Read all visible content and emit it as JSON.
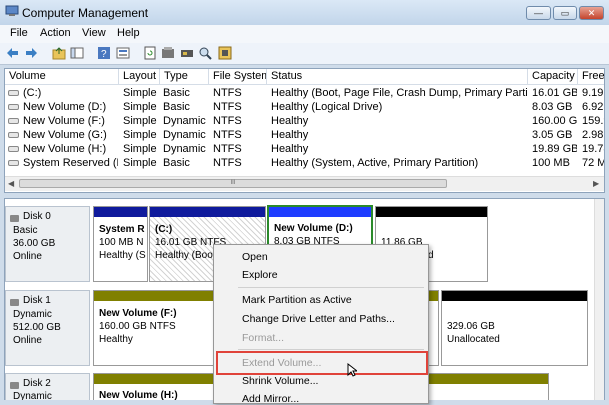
{
  "window": {
    "title": "Computer Management",
    "minimize": "—",
    "maximize": "▭",
    "close": "✕"
  },
  "menu": [
    "File",
    "Action",
    "View",
    "Help"
  ],
  "list": {
    "columns": [
      "Volume",
      "Layout",
      "Type",
      "File System",
      "Status",
      "Capacity",
      "Free"
    ],
    "rows": [
      [
        "(C:)",
        "Simple",
        "Basic",
        "NTFS",
        "Healthy (Boot, Page File, Crash Dump, Primary Partition)",
        "16.01 GB",
        "9.19"
      ],
      [
        "New Volume (D:)",
        "Simple",
        "Basic",
        "NTFS",
        "Healthy (Logical Drive)",
        "8.03 GB",
        "6.92"
      ],
      [
        "New Volume (F:)",
        "Simple",
        "Dynamic",
        "NTFS",
        "Healthy",
        "160.00 GB",
        "159.9"
      ],
      [
        "New Volume (G:)",
        "Simple",
        "Dynamic",
        "NTFS",
        "Healthy",
        "3.05 GB",
        "2.98"
      ],
      [
        "New Volume (H:)",
        "Simple",
        "Dynamic",
        "NTFS",
        "Healthy",
        "19.89 GB",
        "19.78"
      ],
      [
        "System Reserved (E:)",
        "Simple",
        "Basic",
        "NTFS",
        "Healthy (System, Active, Primary Partition)",
        "100 MB",
        "72 M"
      ]
    ],
    "scroll_grip": "III"
  },
  "disks": [
    {
      "name": "Disk 0",
      "kind": "Basic",
      "size": "36.00 GB",
      "state": "Online",
      "parts": [
        {
          "title": "System R",
          "line2": "100 MB N",
          "line3": "Healthy (S"
        },
        {
          "title": "(C:)",
          "line2": "16.01 GB NTFS",
          "line3": "Healthy (Boo"
        },
        {
          "title": "New Volume  (D:)",
          "line2": "8.03 GB NTFS",
          "line3": ""
        },
        {
          "title": "",
          "line2": "11.86 GB",
          "line3": "d"
        }
      ]
    },
    {
      "name": "Disk 1",
      "kind": "Dynamic",
      "size": "512.00 GB",
      "state": "Online",
      "parts": [
        {
          "title": "New Volume  (F:)",
          "line2": "160.00 GB NTFS",
          "line3": "Healthy"
        },
        {
          "title": "",
          "line2": "329.06 GB",
          "line3": "Unallocated"
        }
      ]
    },
    {
      "name": "Disk 2",
      "kind": "Dynamic",
      "size": "",
      "state": "",
      "parts": [
        {
          "title": "New Volume  (H:)",
          "line2": "",
          "line3": ""
        }
      ]
    }
  ],
  "context_menu": [
    "Open",
    "Explore",
    "Mark Partition as Active",
    "Change Drive Letter and Paths...",
    "Format...",
    "Extend Volume...",
    "Shrink Volume...",
    "Add Mirror..."
  ],
  "colors": {
    "primary_partition": "#0f1a9c",
    "logical_drive": "#1e3cff",
    "dynamic_volume": "#808000",
    "unallocated": "#000000",
    "highlight": "#e0433a",
    "selection_border": "#2b8a2b"
  }
}
